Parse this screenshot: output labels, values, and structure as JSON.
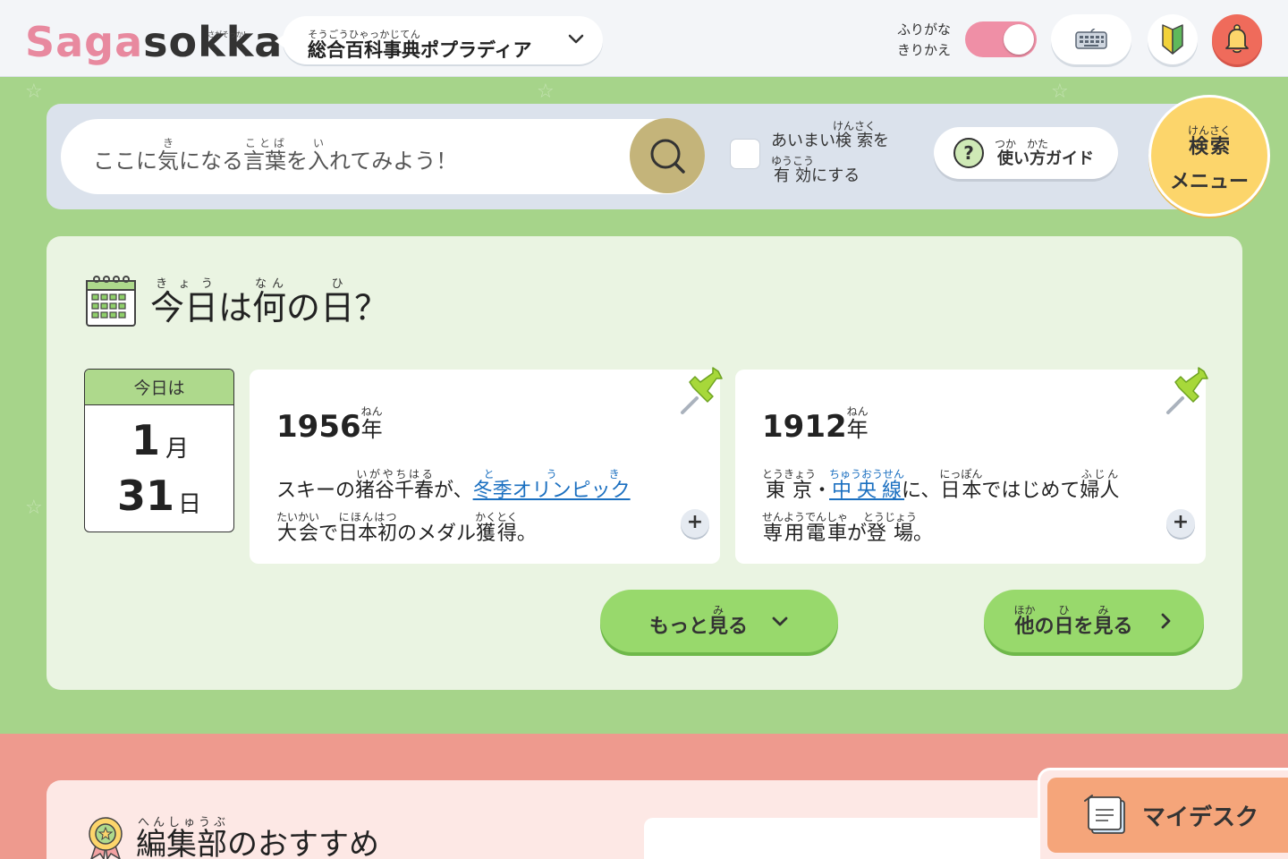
{
  "header": {
    "logo_part1": "Saga",
    "logo_part2": "sokka!",
    "logo_ruby": "さがそっか!",
    "dictionary": {
      "name_parts": [
        {
          "text": "総合百科事典",
          "ruby": "そうごうひゃっかじてん"
        },
        {
          "text": "ポプラディア",
          "ruby": ""
        }
      ]
    },
    "furigana_label_line1": "ふりがな",
    "furigana_label_line2": "きりかえ",
    "furigana_on": true,
    "accent_pink": "#ef8fa6",
    "bell_color": "#ef6b5b"
  },
  "search": {
    "placeholder_parts": [
      {
        "text": "ここに",
        "ruby": ""
      },
      {
        "text": "気",
        "ruby": "き"
      },
      {
        "text": "になる",
        "ruby": ""
      },
      {
        "text": "言葉",
        "ruby": "ことば"
      },
      {
        "text": "を",
        "ruby": ""
      },
      {
        "text": "入",
        "ruby": "い"
      },
      {
        "text": "れてみよう！",
        "ruby": ""
      }
    ],
    "fuzzy_line1_plain": "あいまい",
    "fuzzy_line1_kanji": "検索",
    "fuzzy_line1_ruby": "けんさく",
    "fuzzy_line1_tail": "を",
    "fuzzy_line2_kanji": "有効",
    "fuzzy_line2_ruby": "ゆうこう",
    "fuzzy_line2_tail": "にする",
    "fuzzy_checked": false,
    "guide_kanji1": "使",
    "guide_ruby1": "つか",
    "guide_mid": "い",
    "guide_kanji2": "方",
    "guide_ruby2": "かた",
    "guide_tail": "ガイド",
    "menu_kanji": "検索",
    "menu_ruby": "けんさく",
    "menu_line2": "メニュー"
  },
  "today": {
    "title_parts": [
      {
        "text": "今日",
        "ruby": "きょう"
      },
      {
        "text": "は",
        "ruby": ""
      },
      {
        "text": "何",
        "ruby": "なん"
      },
      {
        "text": "の",
        "ruby": ""
      },
      {
        "text": "日",
        "ruby": "ひ"
      },
      {
        "text": "？",
        "ruby": ""
      }
    ],
    "date_header": "今日は",
    "month": "1",
    "month_unit": "月",
    "day": "31",
    "day_unit": "日",
    "events": [
      {
        "year": "1956",
        "year_unit": "年",
        "year_unit_ruby": "ねん",
        "line1": [
          {
            "text": "スキーの",
            "ruby": ""
          },
          {
            "text": "猪谷千春",
            "ruby": "いがやちはる"
          },
          {
            "text": "が、",
            "ruby": ""
          }
        ],
        "link": {
          "text": "冬季オリンピック",
          "ruby": "とうき"
        },
        "line2": [
          {
            "text": "大会",
            "ruby": "たいかい"
          },
          {
            "text": "で",
            "ruby": ""
          },
          {
            "text": "日本初",
            "ruby": "にほんはつ"
          },
          {
            "text": "のメダル",
            "ruby": ""
          },
          {
            "text": "獲得",
            "ruby": "かくとく"
          },
          {
            "text": "。",
            "ruby": ""
          }
        ]
      },
      {
        "year": "1912",
        "year_unit": "年",
        "year_unit_ruby": "ねん",
        "line1": [
          {
            "text": "東京",
            "ruby": "とうきょう"
          },
          {
            "text": "・",
            "ruby": ""
          }
        ],
        "link": {
          "text": "中央線",
          "ruby": "ちゅうおうせん"
        },
        "line1_tail": [
          {
            "text": "に、",
            "ruby": ""
          },
          {
            "text": "日本",
            "ruby": "にっぽん"
          },
          {
            "text": "ではじめて",
            "ruby": ""
          },
          {
            "text": "婦人",
            "ruby": "ふじん"
          }
        ],
        "line2": [
          {
            "text": "専用電車",
            "ruby": "せんようでんしゃ"
          },
          {
            "text": "が",
            "ruby": ""
          },
          {
            "text": "登場",
            "ruby": "とうじょう"
          },
          {
            "text": "。",
            "ruby": ""
          }
        ]
      }
    ],
    "more_pre": "もっと",
    "more_kanji": "見",
    "more_ruby": "み",
    "more_tail": "る",
    "other_kanji1": "他",
    "other_ruby1": "ほか",
    "other_mid": "の",
    "other_kanji2": "日",
    "other_ruby2": "ひ",
    "other_mid2": "を",
    "other_kanji3": "見",
    "other_ruby3": "み",
    "other_tail": "る"
  },
  "recommend": {
    "title_kanji": "編集部",
    "title_ruby": "へんしゅうぶ",
    "title_tail": "のおすすめ"
  },
  "mydesk": {
    "label": "マイデスク"
  }
}
